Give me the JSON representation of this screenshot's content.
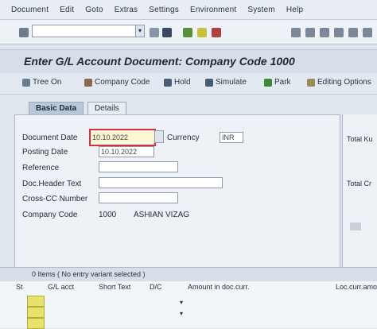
{
  "menu": [
    "Document",
    "Edit",
    "Goto",
    "Extras",
    "Settings",
    "Environment",
    "System",
    "Help"
  ],
  "title": "Enter G/L Account Document: Company Code 1000",
  "app_toolbar": {
    "tree_on": "Tree On",
    "company_code": "Company Code",
    "hold": "Hold",
    "simulate": "Simulate",
    "park": "Park",
    "editing_options": "Editing Options"
  },
  "tabs": {
    "basic_data": "Basic Data",
    "details": "Details"
  },
  "form": {
    "document_date_label": "Document Date",
    "document_date_value": "10.10.2022",
    "currency_label": "Currency",
    "currency_value": "INR",
    "posting_date_label": "Posting Date",
    "posting_date_value": "10.10.2022",
    "reference_label": "Reference",
    "doc_header_text_label": "Doc.Header Text",
    "cross_cc_label": "Cross-CC Number",
    "company_code_label": "Company Code",
    "company_code_value": "1000",
    "company_name": "ASHIAN VIZAG"
  },
  "right_panel": {
    "total_debit": "Total Ku",
    "total_credit": "Total Cr"
  },
  "items_bar": "0 Items ( No entry variant selected )",
  "grid_headers": [
    "St",
    "G/L acct",
    "Short Text",
    "D/C",
    "Amount in doc.curr.",
    "Loc.curr.amount"
  ]
}
